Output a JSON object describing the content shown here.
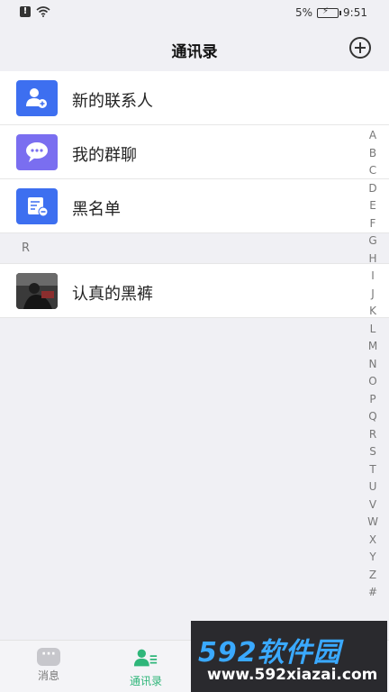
{
  "status_bar": {
    "battery": "5%",
    "time": "9:51"
  },
  "header": {
    "title": "通讯录"
  },
  "entries": [
    {
      "label": "新的联系人",
      "icon": "add-user-icon",
      "color": "#3d6ff0"
    },
    {
      "label": "我的群聊",
      "icon": "group-chat-icon",
      "color": "#7a6ef0"
    },
    {
      "label": "黑名单",
      "icon": "blacklist-icon",
      "color": "#3d6ff0"
    }
  ],
  "sections": [
    {
      "letter": "R",
      "contacts": [
        {
          "name": "认真的黑裤"
        }
      ]
    }
  ],
  "alphabet_index": [
    "A",
    "B",
    "C",
    "D",
    "E",
    "F",
    "G",
    "H",
    "I",
    "J",
    "K",
    "L",
    "M",
    "N",
    "O",
    "P",
    "Q",
    "R",
    "S",
    "T",
    "U",
    "V",
    "W",
    "X",
    "Y",
    "Z",
    "#"
  ],
  "bottom_nav": {
    "messages": "消息",
    "contacts": "通讯录"
  },
  "watermark": {
    "top": "592软件园",
    "bottom": "www.592xiazai.com"
  },
  "accent_color": "#2fb67a"
}
